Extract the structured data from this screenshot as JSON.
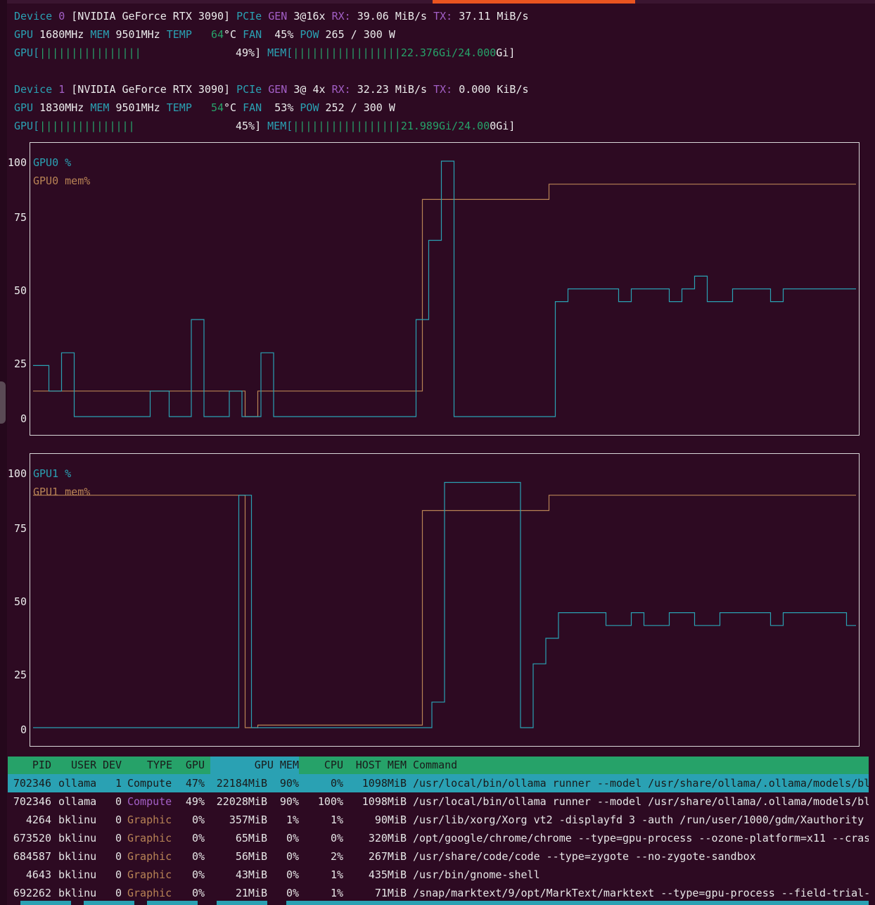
{
  "accent_color": "#e95420",
  "colors": {
    "cyan": "#2aa1b3",
    "magenta": "#a35fc6",
    "green": "#26a269",
    "tan": "#b88355",
    "bg": "#2d0a22"
  },
  "devices": [
    {
      "line1": {
        "device": "Device",
        "idx": "0",
        "name": "[NVIDIA GeForce RTX 3090]",
        "pcie": "PCIe",
        "gen": "GEN",
        "gen_val": "3@16x",
        "rx": "RX:",
        "rx_val": "39.06 MiB/s",
        "tx": "TX:",
        "tx_val": "37.11 MiB/s"
      },
      "line2": {
        "gpu": "GPU",
        "gpu_clk": "1680MHz",
        "mem": "MEM",
        "mem_clk": "9501MHz",
        "temp": "TEMP",
        "temp_val": "64",
        "temp_unit": "°C",
        "fan": "FAN",
        "fan_val": "45%",
        "pow": "POW",
        "pow_val": "265 / 300 W"
      },
      "line3": {
        "gpu_label": "GPU[",
        "gpu_bars": "||||||||||||||||",
        "gpu_pct": "49%]",
        "mem_label": "MEM[",
        "mem_bars": "|||||||||||||||||",
        "mem_used": "22.376Gi/24.000",
        "mem_tail": "Gi]"
      },
      "gpu_util": 0.49,
      "mem_util": 0.93
    },
    {
      "line1": {
        "device": "Device",
        "idx": "1",
        "name": "[NVIDIA GeForce RTX 3090]",
        "pcie": "PCIe",
        "gen": "GEN",
        "gen_val": "3@ 4x",
        "rx": "RX:",
        "rx_val": "32.23 MiB/s",
        "tx": "TX:",
        "tx_val": "0.000 KiB/s"
      },
      "line2": {
        "gpu": "GPU",
        "gpu_clk": "1830MHz",
        "mem": "MEM",
        "mem_clk": "9501MHz",
        "temp": "TEMP",
        "temp_val": "54",
        "temp_unit": "°C",
        "fan": "FAN",
        "fan_val": "53%",
        "pow": "POW",
        "pow_val": "252 / 300 W"
      },
      "line3": {
        "gpu_label": "GPU[",
        "gpu_bars": "|||||||||||||||",
        "gpu_pct": "45%]",
        "mem_label": "MEM[",
        "mem_bars": "|||||||||||||||||",
        "mem_used": "21.989Gi/24.00",
        "mem_tail": "0Gi]"
      },
      "gpu_util": 0.45,
      "mem_util": 0.92
    }
  ],
  "chart_data": [
    {
      "type": "line",
      "y_ticks": [
        "100",
        "75",
        "50",
        "25",
        "0"
      ],
      "ylim": [
        0,
        100
      ],
      "xlim": [
        0,
        130
      ],
      "series": [
        {
          "name": "GPU0 %",
          "color": "#2aa1b3",
          "points": [
            [
              0,
              20
            ],
            [
              2.5,
              20
            ],
            [
              2.5,
              10
            ],
            [
              4.5,
              10
            ],
            [
              4.5,
              25
            ],
            [
              6.5,
              25
            ],
            [
              6.5,
              0
            ],
            [
              18.5,
              0
            ],
            [
              18.5,
              10
            ],
            [
              21.5,
              10
            ],
            [
              21.5,
              0
            ],
            [
              25,
              0
            ],
            [
              25,
              38
            ],
            [
              27,
              38
            ],
            [
              27,
              0
            ],
            [
              31,
              0
            ],
            [
              31,
              10
            ],
            [
              33,
              10
            ],
            [
              33,
              0
            ],
            [
              36,
              0
            ],
            [
              36,
              25
            ],
            [
              38,
              25
            ],
            [
              38,
              0
            ],
            [
              60.5,
              0
            ],
            [
              60.5,
              38
            ],
            [
              62.5,
              38
            ],
            [
              62.5,
              69
            ],
            [
              64.5,
              69
            ],
            [
              64.5,
              100
            ],
            [
              66.5,
              100
            ],
            [
              66.5,
              0
            ],
            [
              82.5,
              0
            ],
            [
              82.5,
              45
            ],
            [
              84.5,
              45
            ],
            [
              84.5,
              50
            ],
            [
              92.5,
              50
            ],
            [
              92.5,
              45
            ],
            [
              94.5,
              45
            ],
            [
              94.5,
              50
            ],
            [
              100.5,
              50
            ],
            [
              100.5,
              45
            ],
            [
              102.5,
              45
            ],
            [
              102.5,
              50
            ],
            [
              104.5,
              50
            ],
            [
              104.5,
              55
            ],
            [
              106.5,
              55
            ],
            [
              106.5,
              45
            ],
            [
              110.5,
              45
            ],
            [
              110.5,
              50
            ],
            [
              116.5,
              50
            ],
            [
              116.5,
              45
            ],
            [
              118.5,
              45
            ],
            [
              118.5,
              50
            ],
            [
              130,
              50
            ]
          ]
        },
        {
          "name": "GPU0 mem%",
          "color": "#b88355",
          "points": [
            [
              0,
              10
            ],
            [
              33.5,
              10
            ],
            [
              33.5,
              0
            ],
            [
              35.5,
              0
            ],
            [
              35.5,
              10
            ],
            [
              61.5,
              10
            ],
            [
              61.5,
              85
            ],
            [
              81.5,
              85
            ],
            [
              81.5,
              91
            ],
            [
              130,
              91
            ]
          ]
        }
      ]
    },
    {
      "type": "line",
      "y_ticks": [
        "100",
        "75",
        "50",
        "25",
        "0"
      ],
      "ylim": [
        0,
        100
      ],
      "xlim": [
        0,
        130
      ],
      "series": [
        {
          "name": "GPU1 %",
          "color": "#2aa1b3",
          "points": [
            [
              0,
              0
            ],
            [
              32.5,
              0
            ],
            [
              32.5,
              91
            ],
            [
              34.5,
              91
            ],
            [
              34.5,
              0
            ],
            [
              63,
              0
            ],
            [
              63,
              10
            ],
            [
              65,
              10
            ],
            [
              65,
              96
            ],
            [
              77,
              96
            ],
            [
              77,
              0
            ],
            [
              79,
              0
            ],
            [
              79,
              25
            ],
            [
              81,
              25
            ],
            [
              81,
              35
            ],
            [
              83,
              35
            ],
            [
              83,
              45
            ],
            [
              90.5,
              45
            ],
            [
              90.5,
              40
            ],
            [
              94.5,
              40
            ],
            [
              94.5,
              45
            ],
            [
              96.5,
              45
            ],
            [
              96.5,
              40
            ],
            [
              100.5,
              40
            ],
            [
              100.5,
              45
            ],
            [
              104.5,
              45
            ],
            [
              104.5,
              40
            ],
            [
              108.5,
              40
            ],
            [
              108.5,
              45
            ],
            [
              116.5,
              45
            ],
            [
              116.5,
              40
            ],
            [
              118.5,
              40
            ],
            [
              118.5,
              45
            ],
            [
              128.5,
              45
            ],
            [
              128.5,
              40
            ],
            [
              130,
              40
            ]
          ]
        },
        {
          "name": "GPU1 mem%",
          "color": "#b88355",
          "points": [
            [
              0,
              91
            ],
            [
              33.5,
              91
            ],
            [
              33.5,
              0
            ],
            [
              35.5,
              0
            ],
            [
              35.5,
              1
            ],
            [
              61.5,
              1
            ],
            [
              61.5,
              85
            ],
            [
              81.5,
              85
            ],
            [
              81.5,
              91
            ],
            [
              130,
              91
            ]
          ]
        }
      ]
    }
  ],
  "table": {
    "headers": [
      "PID",
      "USER",
      "DEV",
      "TYPE",
      "GPU",
      "GPU MEM",
      "CPU",
      "HOST MEM",
      "Command"
    ],
    "rows": [
      {
        "pid": "702346",
        "user": "ollama",
        "dev": "1",
        "type": "Compute",
        "gpu": "47%",
        "gpumem": "22184MiB",
        "gmp": "90%",
        "cpu": "0%",
        "host": "1098MiB",
        "cmd": "/usr/local/bin/ollama runner --model /usr/share/ollama/.ollama/models/bl",
        "selected": true
      },
      {
        "pid": "702346",
        "user": "ollama",
        "dev": "0",
        "type": "Compute",
        "gpu": "49%",
        "gpumem": "22028MiB",
        "gmp": "90%",
        "cpu": "100%",
        "host": "1098MiB",
        "cmd": "/usr/local/bin/ollama runner --model /usr/share/ollama/.ollama/models/bl"
      },
      {
        "pid": "4264",
        "user": "bklinu",
        "dev": "0",
        "type": "Graphic",
        "gpu": "0%",
        "gpumem": "357MiB",
        "gmp": "1%",
        "cpu": "1%",
        "host": "90MiB",
        "cmd": "/usr/lib/xorg/Xorg vt2 -displayfd 3 -auth /run/user/1000/gdm/Xauthority"
      },
      {
        "pid": "673520",
        "user": "bklinu",
        "dev": "0",
        "type": "Graphic",
        "gpu": "0%",
        "gpumem": "65MiB",
        "gmp": "0%",
        "cpu": "0%",
        "host": "320MiB",
        "cmd": "/opt/google/chrome/chrome --type=gpu-process --ozone-platform=x11 --cras"
      },
      {
        "pid": "684587",
        "user": "bklinu",
        "dev": "0",
        "type": "Graphic",
        "gpu": "0%",
        "gpumem": "56MiB",
        "gmp": "0%",
        "cpu": "2%",
        "host": "267MiB",
        "cmd": "/usr/share/code/code --type=zygote --no-zygote-sandbox"
      },
      {
        "pid": "4643",
        "user": "bklinu",
        "dev": "0",
        "type": "Graphic",
        "gpu": "0%",
        "gpumem": "43MiB",
        "gmp": "0%",
        "cpu": "1%",
        "host": "435MiB",
        "cmd": "/usr/bin/gnome-shell"
      },
      {
        "pid": "692262",
        "user": "bklinu",
        "dev": "0",
        "type": "Graphic",
        "gpu": "0%",
        "gpumem": "21MiB",
        "gmp": "0%",
        "cpu": "1%",
        "host": "71MiB",
        "cmd": "/snap/marktext/9/opt/MarkText/marktext --type=gpu-process --field-trial-"
      }
    ]
  }
}
